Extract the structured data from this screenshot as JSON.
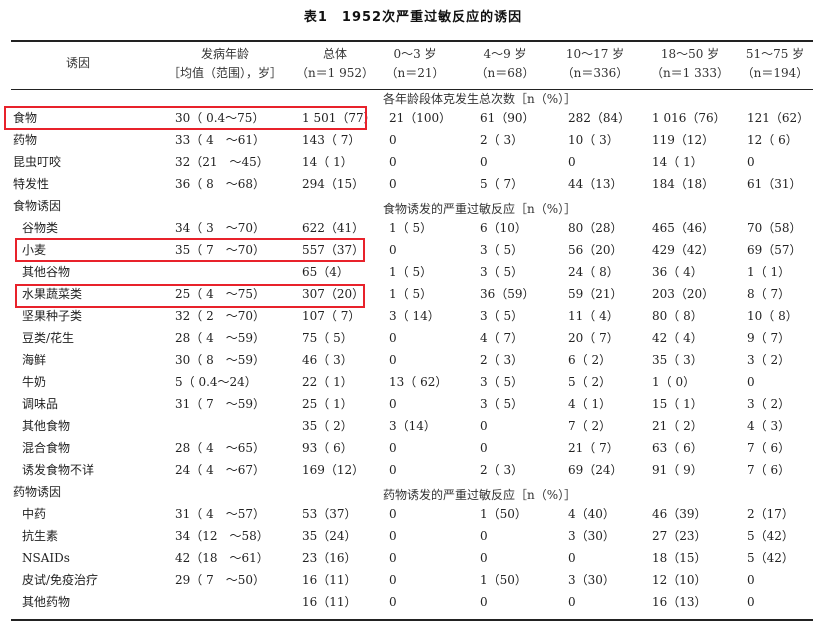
{
  "title": "表1　1952次严重过敏反应的诱因",
  "header": {
    "col_trigger": "诱因",
    "col_age_l1": "发病年龄",
    "col_age_l2": "［均值（范围），岁］",
    "col_total_l1": "总体",
    "col_total_l2": "（n＝1 952）",
    "col_a_l1": "0～3 岁",
    "col_a_l2": "（n＝21）",
    "col_b_l1": "4～9 岁",
    "col_b_l2": "（n＝68）",
    "col_c_l1": "10～17 岁",
    "col_c_l2": "（n＝336）",
    "col_d_l1": "18～50 岁",
    "col_d_l2": "（n＝1 333）",
    "col_e_l1": "51～75 岁",
    "col_e_l2": "（n＝194）"
  },
  "sections": {
    "overall": "各年龄段体克发生总次数［n（%）］",
    "food": "食物诱发的严重过敏反应［n（%）］",
    "drug": "药物诱发的严重过敏反应［n（%）］"
  },
  "rows": [
    {
      "name": "食物",
      "age": "30（ 0.4～75）",
      "total": "1 501（77）",
      "a": "21（100）",
      "b": "61（90）",
      "c": "282（84）",
      "d": "1 016（76）",
      "e": "121（62）"
    },
    {
      "name": "药物",
      "age": "33（ 4　～61）",
      "total": "143（ 7）",
      "a": "0",
      "b": "2（ 3）",
      "c": "10（ 3）",
      "d": "119（12）",
      "e": "12（ 6）"
    },
    {
      "name": "昆虫叮咬",
      "age": "32（21　～45）",
      "total": "14（ 1）",
      "a": "0",
      "b": "0",
      "c": "0",
      "d": "14（ 1）",
      "e": "0"
    },
    {
      "name": "特发性",
      "age": "36（ 8　～68）",
      "total": "294（15）",
      "a": "0",
      "b": "5（ 7）",
      "c": "44（13）",
      "d": "184（18）",
      "e": "61（31）"
    },
    {
      "name": "食物诱因",
      "age": "",
      "total": "",
      "a": "",
      "b": "",
      "c": "",
      "d": "",
      "e": ""
    },
    {
      "name": "谷物类",
      "age": "34（ 3　～70）",
      "total": "622（41）",
      "a": "1（ 5）",
      "b": "6（10）",
      "c": "80（28）",
      "d": "465（46）",
      "e": "70（58）"
    },
    {
      "name": "小麦",
      "age": "35（ 7　～70）",
      "total": "557（37）",
      "a": "0",
      "b": "3（ 5）",
      "c": "56（20）",
      "d": "429（42）",
      "e": "69（57）"
    },
    {
      "name": "其他谷物",
      "age": "",
      "total": "65（4）",
      "a": "1（ 5）",
      "b": "3（ 5）",
      "c": "24（ 8）",
      "d": "36（ 4）",
      "e": "1（ 1）"
    },
    {
      "name": "水果蔬菜类",
      "age": "25（ 4　～75）",
      "total": "307（20）",
      "a": "1（ 5）",
      "b": "36（59）",
      "c": "59（21）",
      "d": "203（20）",
      "e": "8（ 7）"
    },
    {
      "name": "坚果种子类",
      "age": "32（ 2　～70）",
      "total": "107（ 7）",
      "a": "3（ 14）",
      "b": "3（ 5）",
      "c": "11（ 4）",
      "d": "80（ 8）",
      "e": "10（ 8）"
    },
    {
      "name": "豆类/花生",
      "age": "28（ 4　～59）",
      "total": "75（ 5）",
      "a": "0",
      "b": "4（ 7）",
      "c": "20（ 7）",
      "d": "42（ 4）",
      "e": "9（ 7）"
    },
    {
      "name": "海鲜",
      "age": "30（ 8　～59）",
      "total": "46（ 3）",
      "a": "0",
      "b": "2（ 3）",
      "c": "6（ 2）",
      "d": "35（ 3）",
      "e": "3（ 2）"
    },
    {
      "name": "牛奶",
      "age": "5（ 0.4～24）",
      "total": "22（ 1）",
      "a": "13（ 62）",
      "b": "3（ 5）",
      "c": "5（ 2）",
      "d": "1（ 0）",
      "e": "0"
    },
    {
      "name": "调味品",
      "age": "31（ 7　～59）",
      "total": "25（ 1）",
      "a": "0",
      "b": "3（ 5）",
      "c": "4（ 1）",
      "d": "15（ 1）",
      "e": "3（ 2）"
    },
    {
      "name": "其他食物",
      "age": "",
      "total": "35（ 2）",
      "a": "3（14）",
      "b": "0",
      "c": "7（ 2）",
      "d": "21（ 2）",
      "e": "4（ 3）"
    },
    {
      "name": "混合食物",
      "age": "28（ 4　～65）",
      "total": "93（ 6）",
      "a": "0",
      "b": "0",
      "c": "21（ 7）",
      "d": "63（ 6）",
      "e": "7（ 6）"
    },
    {
      "name": "诱发食物不详",
      "age": "24（ 4　～67）",
      "total": "169（12）",
      "a": "0",
      "b": "2（ 3）",
      "c": "69（24）",
      "d": "91（ 9）",
      "e": "7（ 6）"
    },
    {
      "name": "药物诱因",
      "age": "",
      "total": "",
      "a": "",
      "b": "",
      "c": "",
      "d": "",
      "e": ""
    },
    {
      "name": "中药",
      "age": "31（ 4　～57）",
      "total": "53（37）",
      "a": "0",
      "b": "1（50）",
      "c": "4（40）",
      "d": "46（39）",
      "e": "2（17）"
    },
    {
      "name": "抗生素",
      "age": "34（12　～58）",
      "total": "35（24）",
      "a": "0",
      "b": "0",
      "c": "3（30）",
      "d": "27（23）",
      "e": "5（42）"
    },
    {
      "name": "NSAIDs",
      "age": "42（18　～61）",
      "total": "23（16）",
      "a": "0",
      "b": "0",
      "c": "0",
      "d": "18（15）",
      "e": "5（42）"
    },
    {
      "name": "皮试/免疫治疗",
      "age": "29（ 7　～50）",
      "total": "16（11）",
      "a": "0",
      "b": "1（50）",
      "c": "3（30）",
      "d": "12（10）",
      "e": "0"
    },
    {
      "name": "其他药物",
      "age": "",
      "total": "16（11）",
      "a": "0",
      "b": "0",
      "c": "0",
      "d": "16（13）",
      "e": "0"
    }
  ]
}
